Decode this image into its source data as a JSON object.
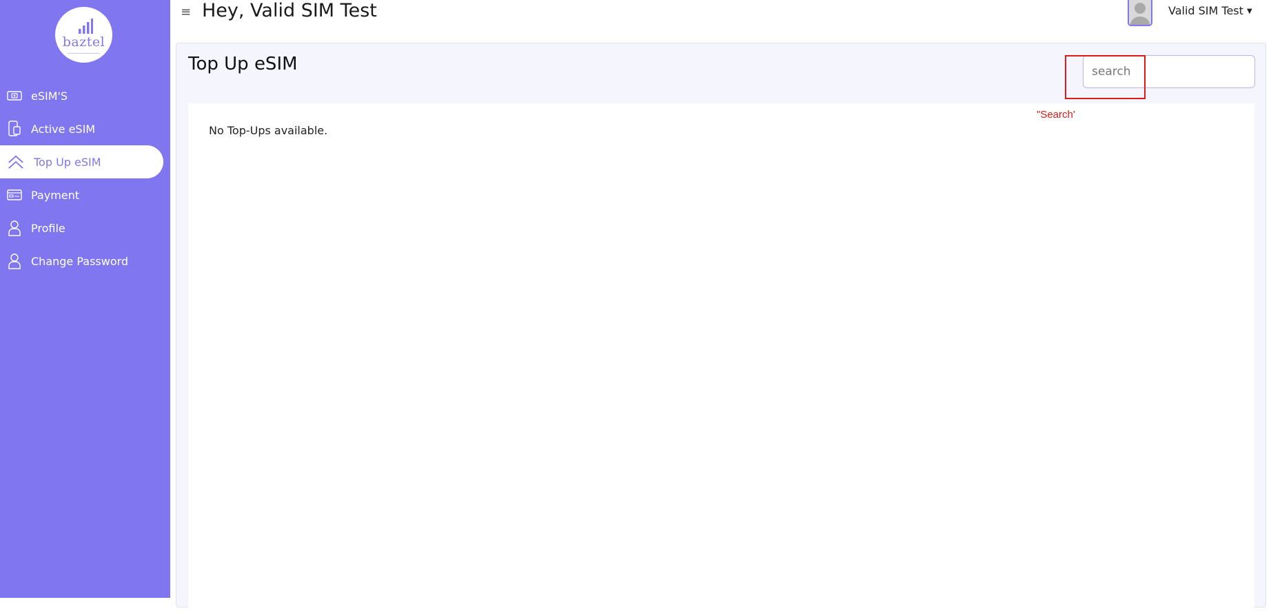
{
  "brand": {
    "logo_text": "baztel"
  },
  "sidebar": {
    "items": [
      {
        "label": "eSIM'S",
        "icon": "esim-card-icon"
      },
      {
        "label": "Active eSIM",
        "icon": "phone-device-icon"
      },
      {
        "label": "Top Up eSIM",
        "icon": "chevrons-up-icon",
        "active": true
      },
      {
        "label": "Payment",
        "icon": "credit-card-icon"
      },
      {
        "label": "Profile",
        "icon": "user-icon"
      },
      {
        "label": "Change Password",
        "icon": "user-icon"
      }
    ]
  },
  "header": {
    "greeting": "Hey, Valid SIM Test",
    "user_name": "Valid SIM Test"
  },
  "main": {
    "title": "Top Up eSIM",
    "search": {
      "placeholder": "search",
      "value": ""
    },
    "empty_message": "No Top-Ups available."
  },
  "annotation": {
    "label": "\"Search'"
  },
  "colors": {
    "accent": "#8077f0",
    "annotation": "#e01818"
  }
}
